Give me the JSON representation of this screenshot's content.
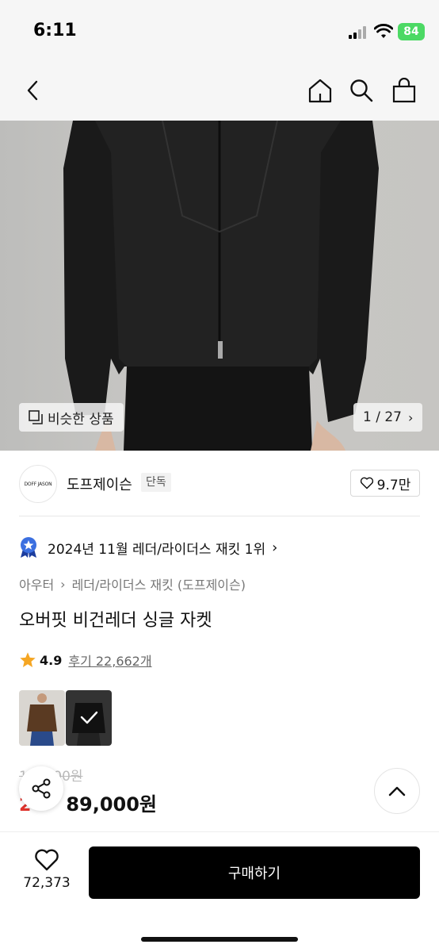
{
  "status_bar": {
    "time": "6:11",
    "battery": "84"
  },
  "nav": {
    "icons": [
      "back-icon",
      "home-icon",
      "search-icon",
      "bag-icon"
    ]
  },
  "hero": {
    "similar_label": "비슷한 상품",
    "pager": "1 / 27"
  },
  "brand": {
    "logo_text": "DOFF JASON",
    "name": "도프제이슨",
    "badge": "단독",
    "likes": "9.7만"
  },
  "ranking": {
    "text": "2024년 11월 레더/라이더스 재킷 1위"
  },
  "breadcrumb": {
    "level1": "아우터",
    "level2": "레더/라이더스 재킷 (도프제이슨)"
  },
  "product": {
    "title": "오버핏 비건레더 싱글 자켓",
    "rating": "4.9",
    "reviews": "후기 22,662개",
    "original_price": "1 0,000원",
    "discount": "2",
    "price": "89,000원"
  },
  "bottom": {
    "wishes": "72,373",
    "buy_label": "구매하기"
  },
  "colors": {
    "accent_red": "#e0322b",
    "star": "#f5a623",
    "rank_badge": "#3b6fe0",
    "buy_bg": "#000000"
  }
}
